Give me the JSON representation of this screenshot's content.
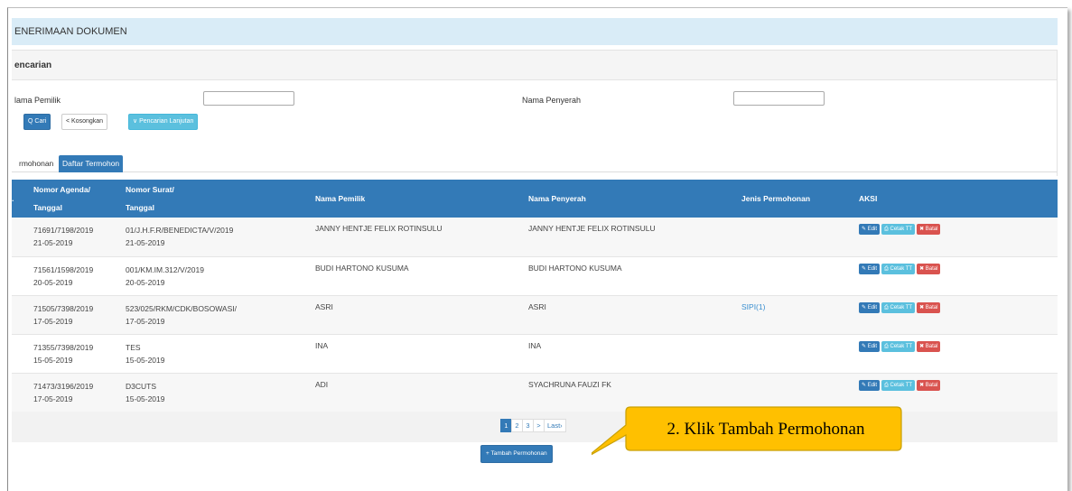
{
  "header": {
    "title": "ENERIMAAN DOKUMEN"
  },
  "search": {
    "panel_title": "encarian",
    "owner_label": "lama Pemilik",
    "owner_value": "",
    "submitter_label": "Nama Penyerah",
    "submitter_value": "",
    "buttons": {
      "search": "Q Cari",
      "clear": "< Kosongkan",
      "advanced": "∨ Pencarian Lanjutan"
    }
  },
  "tabs": [
    {
      "label": "rmohonan",
      "active": false
    },
    {
      "label": "Daftar Termohon",
      "active": true
    }
  ],
  "table": {
    "columns": {
      "no": ".",
      "agenda_line1": "Nomor Agenda/",
      "agenda_line2": "Tanggal",
      "surat_line1": "Nomor Surat/",
      "surat_line2": "Tanggal",
      "pemilik": "Nama Pemilik",
      "penyerah": "Nama Penyerah",
      "jenis": "Jenis Permohonan",
      "aksi": "AKSI"
    },
    "rows": [
      {
        "agenda": "71691/7198/2019",
        "agenda_date": "21-05-2019",
        "surat": "01/J.H.F.R/BENEDICTA/V/2019",
        "surat_date": "21-05-2019",
        "pemilik": "JANNY HENTJE FELIX ROTINSULU",
        "penyerah": "JANNY HENTJE FELIX ROTINSULU",
        "jenis": ""
      },
      {
        "agenda": "71561/1598/2019",
        "agenda_date": "20-05-2019",
        "surat": "001/KM.IM.312/V/2019",
        "surat_date": "20-05-2019",
        "pemilik": "BUDI HARTONO KUSUMA",
        "penyerah": "BUDI HARTONO KUSUMA",
        "jenis": ""
      },
      {
        "agenda": "71505/7398/2019",
        "agenda_date": "17-05-2019",
        "surat": "523/025/RKM/CDK/BOSOWASI/",
        "surat_date": "17-05-2019",
        "pemilik": "ASRI",
        "penyerah": "ASRI",
        "jenis": "SIPI(1)"
      },
      {
        "agenda": "71355/7398/2019",
        "agenda_date": "15-05-2019",
        "surat": "TES",
        "surat_date": "15-05-2019",
        "pemilik": "INA",
        "penyerah": "INA",
        "jenis": ""
      },
      {
        "agenda": "71473/3196/2019",
        "agenda_date": "17-05-2019",
        "surat": "D3CUTS",
        "surat_date": "15-05-2019",
        "pemilik": "ADI",
        "penyerah": "SYACHRUNA FAUZI FK",
        "jenis": ""
      }
    ],
    "actions": {
      "edit": "✎ Edit",
      "cetak": "⎙ Cetak TT",
      "batal": "✖ Batal"
    }
  },
  "pagination": {
    "pages": [
      "1",
      "2",
      "3"
    ],
    "next": ">",
    "last": "Last›",
    "current": "1"
  },
  "add_button": "+ Tambah Permohonan",
  "callout": {
    "text": "2. Klik Tambah Permohonan",
    "fill": "#ffc000",
    "stroke": "#c9a000"
  },
  "colors": {
    "primary": "#337ab7",
    "info": "#5bc0de",
    "danger": "#d9534f",
    "title_bg": "#d9ecf7"
  }
}
